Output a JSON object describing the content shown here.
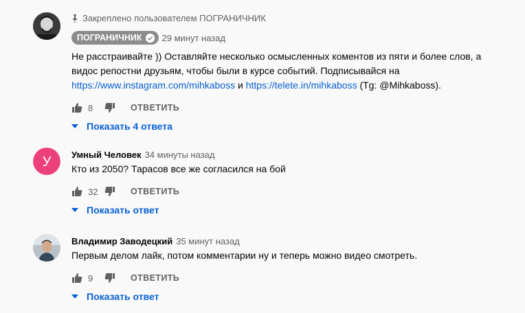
{
  "comments": [
    {
      "pinned_text": "Закреплено пользователем ПОГРАНИЧНИК",
      "author": "ПОГРАНИЧНИК",
      "time": "29 минут назад",
      "text_line1": "Не расстраивайте )) Оставляйте несколько осмысленных  коментов из пяти и более слов, а",
      "text_line2": "видос репостни друзьям, чтобы были в курсе событий. Подписывайся на",
      "link1": "https://www.instagram.com/mihkaboss",
      "and": " и ",
      "link2": "https://telete.in/mihkaboss",
      "tail": " (Tg: @Mihkaboss).",
      "likes": "8",
      "reply_label": "ОТВЕТИТЬ",
      "replies_label": "Показать 4 ответа"
    },
    {
      "author": "Умный Человек",
      "avatar_letter": "У",
      "avatar_color": "#ec407a",
      "time": "34 минуты назад",
      "text": "Кто из 2050? Тарасов все же согласился на бой",
      "likes": "32",
      "reply_label": "ОТВЕТИТЬ",
      "replies_label": "Показать ответ"
    },
    {
      "author": "Владимир Заводецкий",
      "time": "35 минут назад",
      "text": "Первым делом лайк, потом комментарии ну и теперь можно видео смотреть.",
      "likes": "9",
      "reply_label": "ОТВЕТИТЬ",
      "replies_label": "Показать ответ"
    }
  ],
  "colors": {
    "link": "#065fd4",
    "secondary": "#606060",
    "badge": "#8c8c8c"
  },
  "icons": [
    "pin-icon",
    "verified-check-icon",
    "thumb-up-icon",
    "thumb-down-icon",
    "caret-down-icon"
  ]
}
